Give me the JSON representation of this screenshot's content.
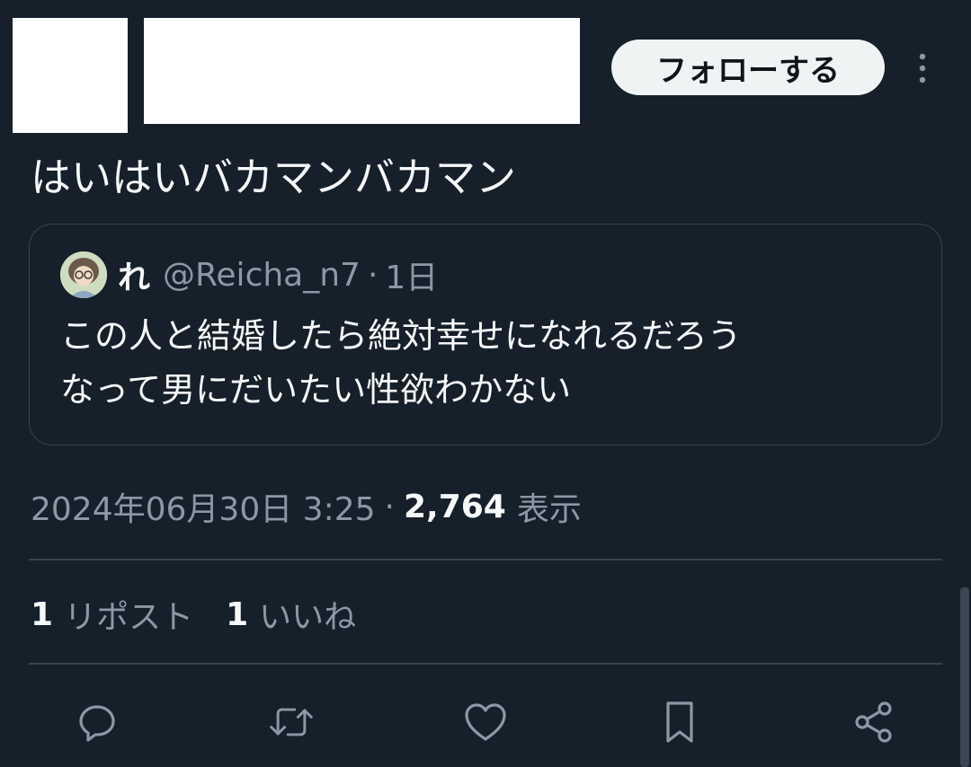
{
  "header": {
    "follow_label": "フォローする",
    "more_icon": "more-vertical-icon"
  },
  "tweet": {
    "text": "はいはいバカマンバカマン"
  },
  "quote": {
    "name": "れ",
    "handle": "@Reicha_n7",
    "separator": "·",
    "time": "1日",
    "lines": [
      "この人と結婚したら絶対幸せになれるだろう",
      "なって男にだいたい性欲わかない"
    ]
  },
  "meta": {
    "timestamp": "2024年06月30日 3:25",
    "separator": "·",
    "views_count": "2,764",
    "views_label": "表示"
  },
  "stats": {
    "reposts_count": "1",
    "reposts_label": "リポスト",
    "likes_count": "1",
    "likes_label": "いいね"
  },
  "actions": [
    "reply-icon",
    "repost-icon",
    "like-icon",
    "bookmark-icon",
    "share-icon"
  ],
  "colors": {
    "background": "#15202b",
    "text": "#f7f9f9",
    "secondary": "#8b98a5",
    "border": "#38444d"
  }
}
